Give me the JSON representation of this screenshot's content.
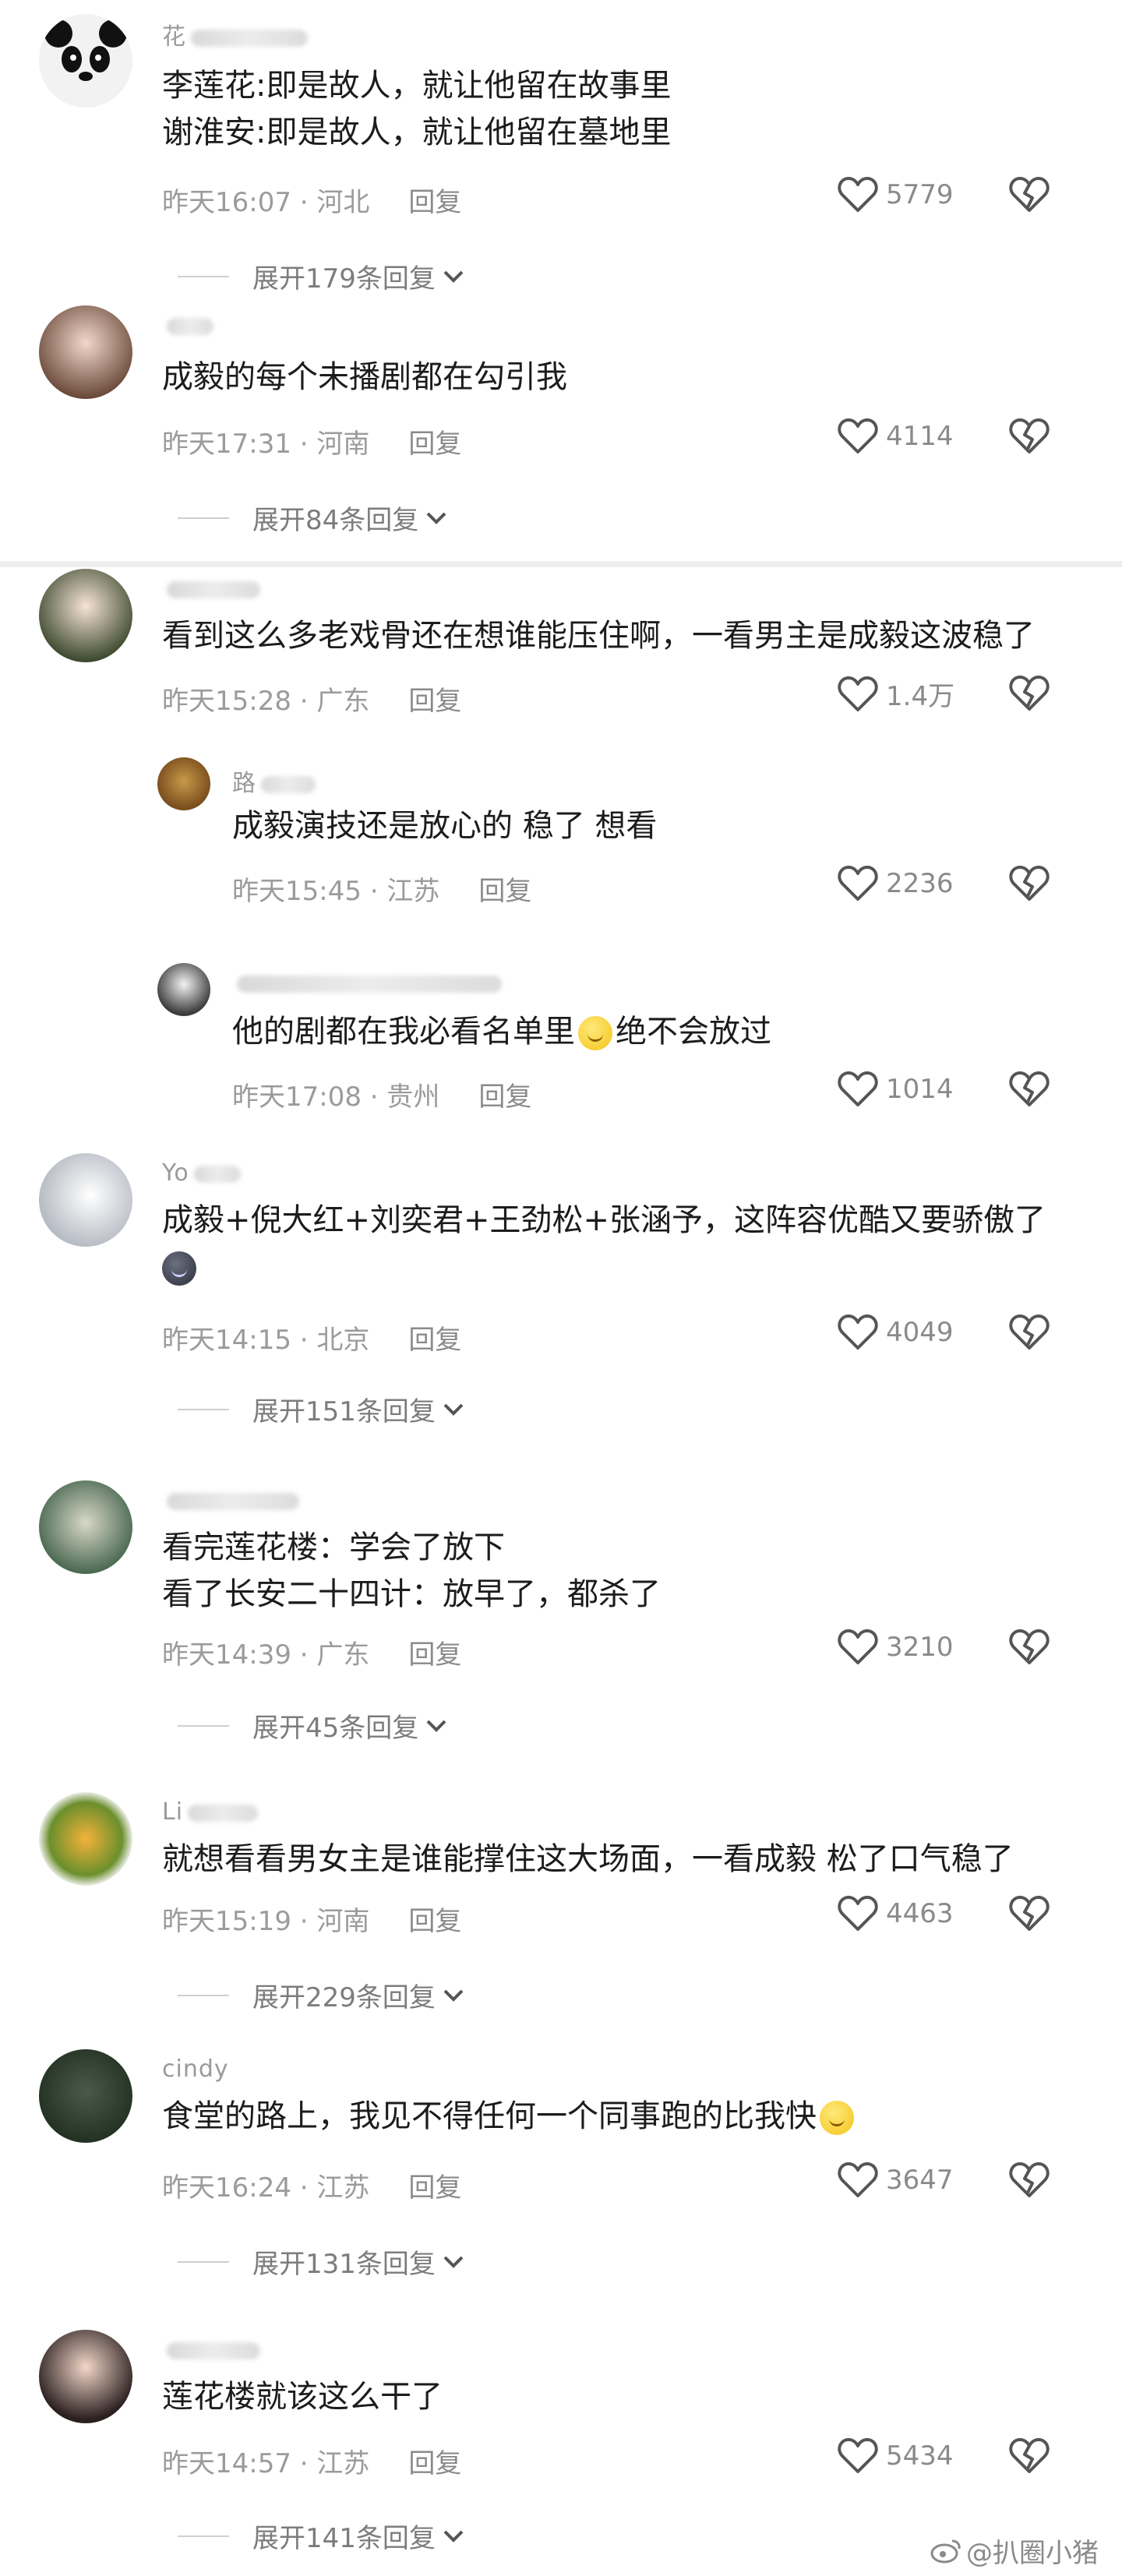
{
  "comments": [
    {
      "user": "花",
      "lines": [
        "李莲花:即是故人，就让他留在故事里",
        "谢淮安:即是故人，就让他留在墓地里"
      ],
      "time": "昨天16:07",
      "region": "河北",
      "reply": "回复",
      "likes": "5779",
      "expand": "展开179条回复"
    },
    {
      "user": "",
      "lines": [
        "成毅的每个未播剧都在勾引我"
      ],
      "time": "昨天17:31",
      "region": "河南",
      "reply": "回复",
      "likes": "4114",
      "expand": "展开84条回复"
    },
    {
      "user": "",
      "lines": [
        "看到这么多老戏骨还在想谁能压住啊，一看男主是成毅这波稳了"
      ],
      "time": "昨天15:28",
      "region": "广东",
      "reply": "回复",
      "likes": "1.4万"
    },
    {
      "user": "路",
      "lines": [
        "成毅演技还是放心的 稳了 想看"
      ],
      "time": "昨天15:45",
      "region": "江苏",
      "reply": "回复",
      "likes": "2236"
    },
    {
      "user": "",
      "lines": [
        "他的剧都在我必看名单里",
        "绝不会放过"
      ],
      "time": "昨天17:08",
      "region": "贵州",
      "reply": "回复",
      "likes": "1014"
    },
    {
      "user": "Yo",
      "lines": [
        "成毅+倪大红+刘奕君+王劲松+张涵予，这阵容优酷又要骄傲了"
      ],
      "time": "昨天14:15",
      "region": "北京",
      "reply": "回复",
      "likes": "4049",
      "expand": "展开151条回复"
    },
    {
      "user": "",
      "lines": [
        "看完莲花楼：学会了放下",
        "看了长安二十四计：放早了，都杀了"
      ],
      "time": "昨天14:39",
      "region": "广东",
      "reply": "回复",
      "likes": "3210",
      "expand": "展开45条回复"
    },
    {
      "user": "Li",
      "lines": [
        "就想看看男女主是谁能撑住这大场面，一看成毅 松了口气稳了"
      ],
      "time": "昨天15:19",
      "region": "河南",
      "reply": "回复",
      "likes": "4463",
      "expand": "展开229条回复"
    },
    {
      "user": "cindy",
      "lines": [
        "食堂的路上，我见不得任何一个同事跑的比我快"
      ],
      "time": "昨天16:24",
      "region": "江苏",
      "reply": "回复",
      "likes": "3647",
      "expand": "展开131条回复"
    },
    {
      "user": "",
      "lines": [
        "莲花楼就该这么干了"
      ],
      "time": "昨天14:57",
      "region": "江苏",
      "reply": "回复",
      "likes": "5434",
      "expand": "展开141条回复"
    }
  ],
  "watermark": "@扒圈小猪",
  "icons": {
    "like": "heart-outline-icon",
    "dislike": "broken-heart-icon",
    "expand": "chevron-down-icon",
    "watermark": "weibo-logo-icon"
  }
}
